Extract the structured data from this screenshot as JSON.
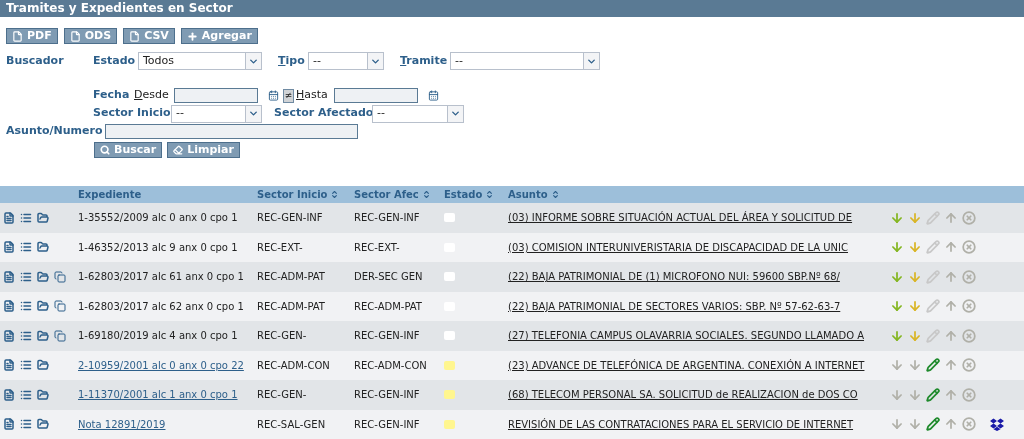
{
  "title": "Tramites y Expedientes en Sector",
  "toolbar": [
    {
      "kind": "file",
      "label": "PDF"
    },
    {
      "kind": "file",
      "label": "ODS"
    },
    {
      "kind": "file",
      "label": "CSV"
    },
    {
      "kind": "add",
      "label": "Agregar"
    }
  ],
  "search": {
    "label": "Buscador",
    "estado": {
      "label": "Estado",
      "value": "Todos"
    },
    "tipo": {
      "label": "Tipo",
      "value": "--"
    },
    "tramite": {
      "label": "Tramite",
      "value": "--"
    },
    "fecha": {
      "label": "Fecha",
      "desde": "Desde",
      "toggle": "≠",
      "hasta": "Hasta"
    },
    "sector_inicio": {
      "label": "Sector Inicio",
      "value": "--"
    },
    "sector_afectado": {
      "label": "Sector Afectado",
      "value": "--"
    },
    "asunto": {
      "label": "Asunto/Numero"
    },
    "buttons": [
      {
        "kind": "search",
        "label": "Buscar"
      },
      {
        "kind": "clear",
        "label": "Limpiar"
      }
    ]
  },
  "table": {
    "columns": [
      "Expediente",
      "Sector Inicio",
      "Sector Afec",
      "Estado",
      "Asunto"
    ],
    "rows": [
      {
        "expediente": "1-35552/2009 alc 0 anx 0 cpo 1",
        "linked": false,
        "copy": false,
        "sector_inicio": "REC-GEN-INF",
        "sector_afec": "REC-GEN-INF",
        "color": "#ffffff",
        "asunto": "(03) INFORME SOBRE SITUACIÓN ACTUAL DEL ÁREA Y SOLICITUD DE",
        "receive": true,
        "edit": false,
        "dropbox": false
      },
      {
        "expediente": "1-46352/2013 alc 9 anx 0 cpo 1",
        "linked": false,
        "copy": false,
        "sector_inicio": "REC-EXT-",
        "sector_afec": "REC-EXT-",
        "color": "#ffffff",
        "asunto": "(03) COMISION INTERUNIVERISTARIA DE DISCAPACIDAD DE LA UNIC",
        "receive": true,
        "edit": false,
        "dropbox": false
      },
      {
        "expediente": "1-62803/2017 alc 61 anx 0 cpo 1",
        "linked": false,
        "copy": true,
        "sector_inicio": "REC-ADM-PAT",
        "sector_afec": "DER-SEC GEN",
        "color": "#ffffff",
        "asunto": "(22) BAJA PATRIMONIAL DE (1) MICROFONO NUI: 59600 SBP.Nº 68/",
        "receive": true,
        "edit": false,
        "dropbox": false
      },
      {
        "expediente": "1-62803/2017 alc 62 anx 0 cpo 1",
        "linked": false,
        "copy": true,
        "sector_inicio": "REC-ADM-PAT",
        "sector_afec": "REC-ADM-PAT",
        "color": "#ffffff",
        "asunto": "(22) BAJA PATRIMONIAL DE SECTORES VARIOS: SBP. Nº 57-62-63-7",
        "receive": true,
        "edit": false,
        "dropbox": false
      },
      {
        "expediente": "1-69180/2019 alc 4 anx 0 cpo 1",
        "linked": false,
        "copy": true,
        "sector_inicio": "REC-GEN-",
        "sector_afec": "REC-GEN-INF",
        "color": "#ffffff",
        "asunto": "(27) TELEFONIA CAMPUS OLAVARRIA SOCIALES. SEGUNDO LLAMADO A",
        "receive": true,
        "edit": false,
        "dropbox": false
      },
      {
        "expediente": "2-10959/2001 alc 0 anx 0 cpo 22",
        "linked": true,
        "copy": false,
        "sector_inicio": "REC-ADM-CON",
        "sector_afec": "REC-ADM-CON",
        "color": "#fff68f",
        "asunto": "(23) ADVANCE DE TELEFÓNICA DE ARGENTINA. CONEXIÓN A INTERNET",
        "receive": false,
        "edit": true,
        "dropbox": false
      },
      {
        "expediente": "1-11370/2001 alc 1 anx 0 cpo 1",
        "linked": true,
        "copy": false,
        "sector_inicio": "REC-GEN-",
        "sector_afec": "REC-GEN-INF",
        "color": "#fff68f",
        "asunto": "(68) TELECOM PERSONAL SA. SOLICITUD de REALIZACION de DOS CO",
        "receive": false,
        "edit": true,
        "dropbox": false
      },
      {
        "expediente": "Nota 12891/2019",
        "linked": true,
        "copy": false,
        "sector_inicio": "REC-SAL-GEN",
        "sector_afec": "REC-GEN-INF",
        "color": "#fff68f",
        "asunto": "REVISIÓN DE LAS CONTRATACIONES PARA EL SERVICIO DE INTERNET",
        "receive": false,
        "edit": true,
        "dropbox": true
      }
    ]
  }
}
